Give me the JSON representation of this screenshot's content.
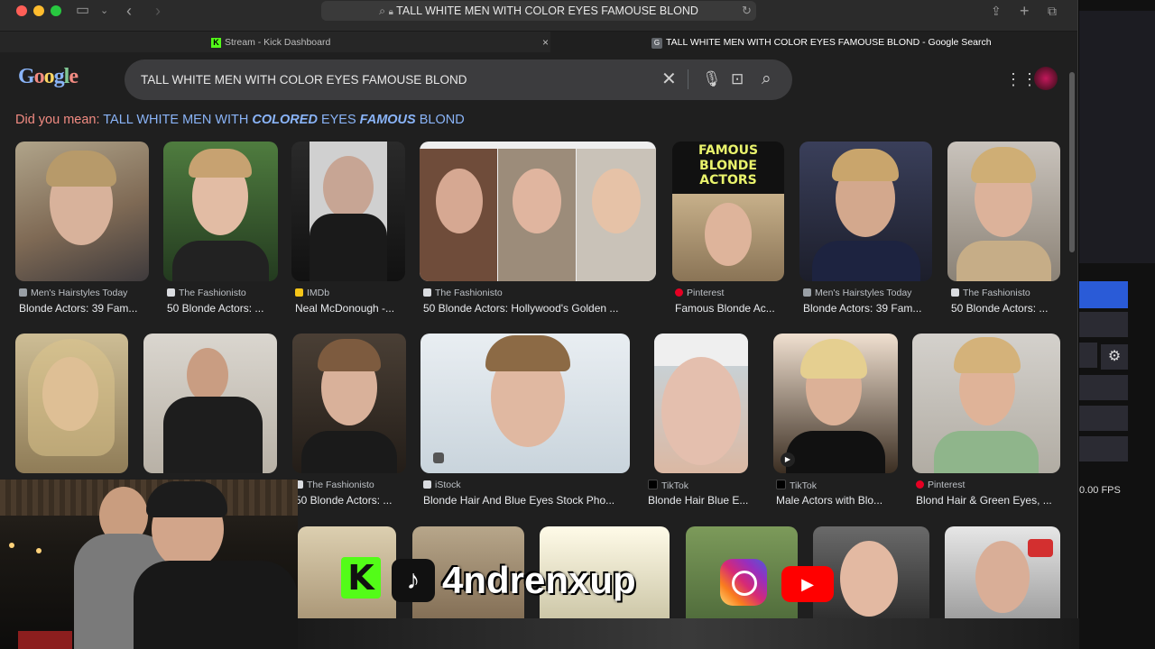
{
  "browser": {
    "url_text": "TALL WHITE MEN WITH COLOR EYES FAMOUSE BLOND",
    "tabs": [
      {
        "label": "Stream - Kick Dashboard",
        "favicon": "K"
      },
      {
        "label": "TALL WHITE MEN WITH COLOR EYES FAMOUSE BLOND - Google Search",
        "favicon": "G"
      }
    ]
  },
  "search": {
    "query": "TALL WHITE MEN WITH COLOR EYES FAMOUSE BLOND",
    "logo_text": "Google"
  },
  "did_you_mean": {
    "prefix": "Did you mean:",
    "parts": [
      "TALL WHITE MEN WITH ",
      "COLORED",
      " EYES ",
      "FAMOUS",
      " BLOND"
    ]
  },
  "results": [
    {
      "source": "Men's Hairstyles Today",
      "title": "Blonde Actors: 39 Fam...",
      "fav": "#9aa0a6"
    },
    {
      "source": "The Fashionisto",
      "title": "50 Blonde Actors: ...",
      "fav": "#dadce0"
    },
    {
      "source": "IMDb",
      "title": "Neal McDonough -...",
      "fav": "#f5c518"
    },
    {
      "source": "The Fashionisto",
      "title": "50 Blonde Actors: Hollywood's Golden ...",
      "fav": "#dadce0"
    },
    {
      "source": "Pinterest",
      "title": "Famous Blonde Ac...",
      "fav": "#e60023"
    },
    {
      "source": "Men's Hairstyles Today",
      "title": "Blonde Actors: 39 Fam...",
      "fav": "#9aa0a6"
    },
    {
      "source": "The Fashionisto",
      "title": "50 Blonde Actors: ...",
      "fav": "#dadce0"
    },
    {
      "source": "The Fashionisto",
      "title": "50 Blonde Actors: ...",
      "fav": "#dadce0"
    },
    {
      "source": "iStock",
      "title": "Blonde Hair And Blue Eyes Stock Pho...",
      "fav": "#dadce0"
    },
    {
      "source": "TikTok",
      "title": "Blonde Hair Blue E...",
      "fav": "#000000"
    },
    {
      "source": "TikTok",
      "title": "Male Actors with Blo...",
      "fav": "#000000"
    },
    {
      "source": "Pinterest",
      "title": "Blond Hair & Green Eyes, ...",
      "fav": "#e60023"
    }
  ],
  "image_text": {
    "famous_blonde": "FAMOUS BLONDE ACTORS"
  },
  "stream_overlay": {
    "handle": "4ndrenxup"
  },
  "obs_panel": {
    "fps": "0.00 FPS"
  }
}
